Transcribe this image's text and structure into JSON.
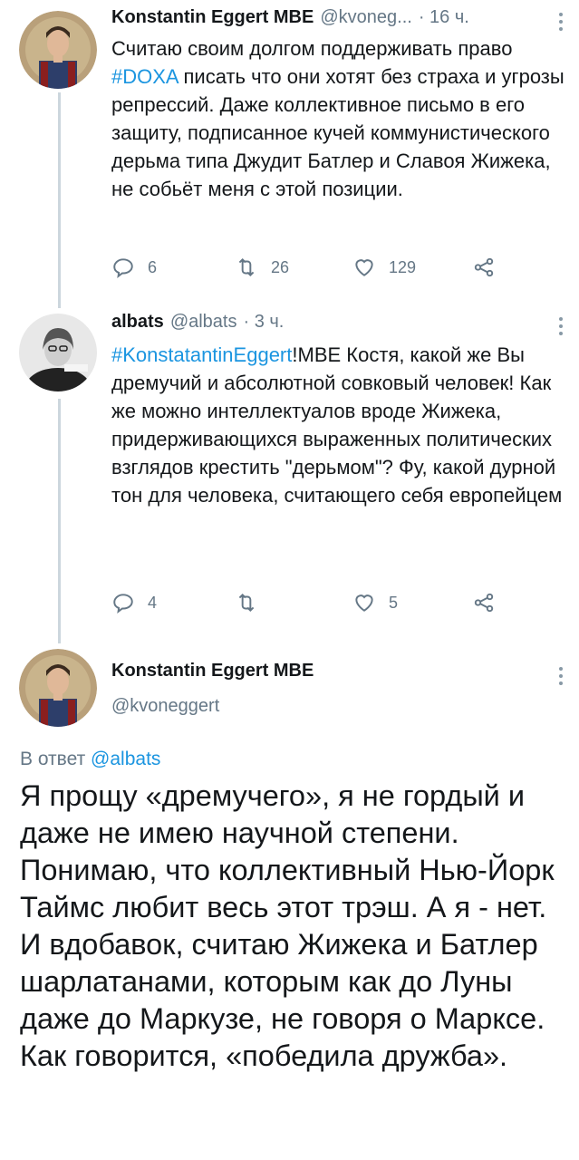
{
  "tweet1": {
    "name": "Konstantin Eggert MBE",
    "handle": "@kvoneg...",
    "time": "· 16 ч.",
    "text_part1": "Считаю своим долгом поддерживать право ",
    "hashtag": "#DOXA",
    "text_part2": " писать что они хотят без страха и угрозы репрессий. Даже коллективное письмо в его защиту, подписанное кучей коммунистического дерьма типа Джудит Батлер и Славоя Жижека, не собьёт меня с этой позиции.",
    "replies": "6",
    "retweets": "26",
    "likes": "129"
  },
  "tweet2": {
    "name": "albats",
    "handle": "@albats",
    "time": "· 3 ч.",
    "hashtag": "#KonstatantinEggert",
    "text": "!MBE Костя, какой же Вы дремучий и абсолютной совковый человек! Как же можно интеллектуалов вроде Жижека, придерживающихся выраженных политических взглядов крестить \"дерьмом\"? Фу, какой дурной тон для человека, считающего себя европейцем",
    "replies": "4",
    "retweets": "",
    "likes": "5"
  },
  "tweet3": {
    "name": "Konstantin Eggert MBE",
    "handle": "@kvoneggert",
    "reply_prefix": "В ответ ",
    "reply_handle": "@albats",
    "text": "Я прощу «дремучего», я не гордый и даже не имею научной степени. Понимаю, что коллективный Нью-Йорк Таймс любит весь этот трэш. А я - нет. И вдобавок, считаю Жижека и Батлер шарлатанами, которым как до Луны даже до Маркузе, не говоря о Марксе. Как говорится, «победила дружба»."
  },
  "colors": {
    "link": "#1b95e0",
    "muted": "#657786",
    "text": "#14171a",
    "thread_line": "#ccd6dd"
  },
  "icons": [
    "reply-icon",
    "retweet-icon",
    "like-icon",
    "share-icon",
    "more-icon"
  ]
}
